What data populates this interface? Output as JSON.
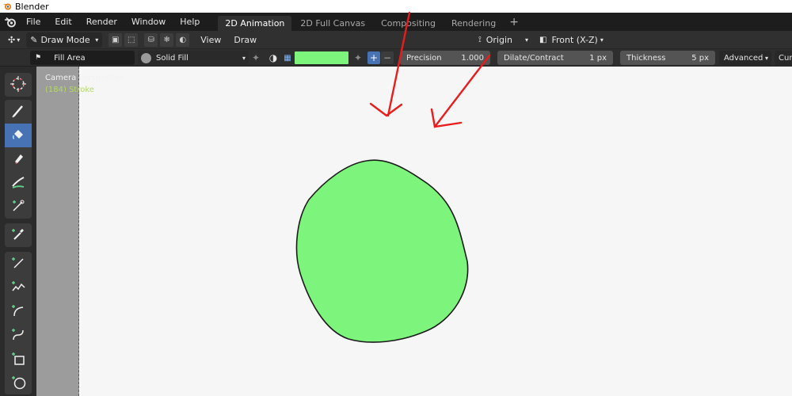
{
  "window": {
    "title": "Blender"
  },
  "menu": [
    "File",
    "Edit",
    "Render",
    "Window",
    "Help"
  ],
  "workspaces": {
    "tabs": [
      {
        "label": "2D Animation",
        "active": true
      },
      {
        "label": "2D Full Canvas",
        "active": false
      },
      {
        "label": "Compositing",
        "active": false
      },
      {
        "label": "Rendering",
        "active": false
      }
    ],
    "add_label": "+"
  },
  "header": {
    "mode_label": "Draw Mode",
    "view_label": "View",
    "draw_label": "Draw",
    "origin_label": "Origin",
    "view_axis_label": "Front (X-Z)"
  },
  "tool_settings": {
    "fill_label": "Fill Area",
    "material_label": "Solid Fill",
    "fill_color": "#7df57d",
    "precision_label": "Precision",
    "precision_value": "1.000",
    "dilate_label": "Dilate/Contract",
    "dilate_value": "1 px",
    "thickness_label": "Thickness",
    "thickness_value": "5 px",
    "advanced_label": "Advanced",
    "cursor_label": "Cur"
  },
  "viewport": {
    "camera_label": "Camera Perspective",
    "stroke_label": "(184) Stroke",
    "shape_fill_color": "#7df57d",
    "annotation_color": "#e81c1c"
  },
  "left_tools": [
    "cursor-icon",
    "draw-brush-icon",
    "fill-bucket-icon",
    "erase-icon",
    "tint-icon",
    "cutter-icon",
    "eyedropper-icon",
    "line-icon",
    "polyline-icon",
    "arc-icon",
    "curve-icon",
    "box-icon",
    "circle-icon"
  ]
}
